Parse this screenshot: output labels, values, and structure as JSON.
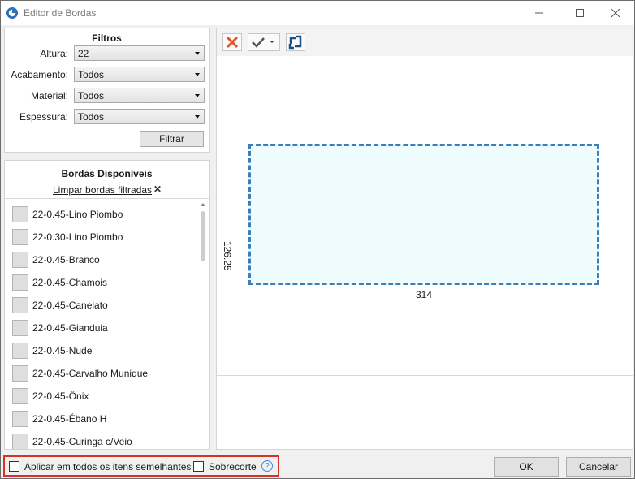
{
  "window": {
    "title": "Editor de Bordas"
  },
  "filtros": {
    "title": "Filtros",
    "rows": [
      {
        "label": "Altura:",
        "value": "22"
      },
      {
        "label": "Acabamento:",
        "value": "Todos"
      },
      {
        "label": "Material:",
        "value": "Todos"
      },
      {
        "label": "Espessura:",
        "value": "Todos"
      }
    ],
    "filter_button": "Filtrar"
  },
  "bordas": {
    "title": "Bordas Disponíveis",
    "clear_link": "Limpar bordas filtradas",
    "clear_icon": "✕",
    "items": [
      "22-0.45-Lino Piombo",
      "22-0.30-Lino Piombo",
      "22-0.45-Branco",
      "22-0.45-Chamois",
      "22-0.45-Canelato",
      "22-0.45-Gianduia",
      "22-0.45-Nude",
      "22-0.45-Carvalho Munique",
      "22-0.45-Ônix",
      "22-0.45-Ébano H",
      "22-0.45-Curinga c/Veio"
    ]
  },
  "preview": {
    "width_label": "314",
    "height_label": "126.25",
    "fill_color": "#effcfd",
    "border_color": "#3b7fb6"
  },
  "toolbar": {
    "icons": [
      "delete-icon",
      "check-dropdown-icon",
      "rotate-icon"
    ]
  },
  "footer": {
    "apply_all_label": "Aplicar em todos os itens semelhantes",
    "sobrecorte_label": "Sobrecorte",
    "help_icon": "?",
    "ok_label": "OK",
    "cancel_label": "Cancelar"
  },
  "colors": {
    "highlight_border": "#d63226",
    "accent": "#3b7fb6"
  }
}
